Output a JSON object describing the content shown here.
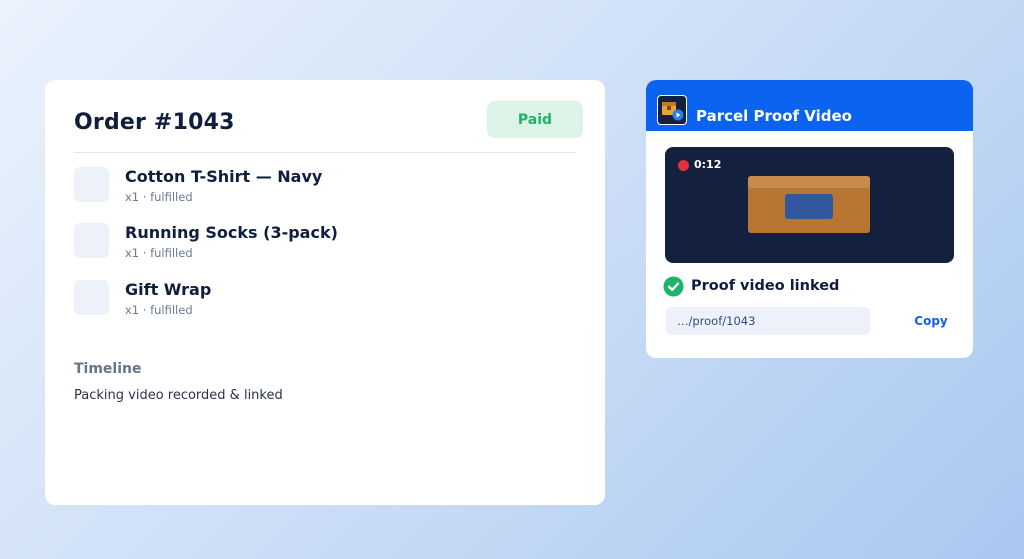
{
  "order": {
    "title": "Order #1043",
    "status_badge": "Paid",
    "items": [
      {
        "name": "Cotton T-Shirt — Navy",
        "meta": "x1 · fulfilled"
      },
      {
        "name": "Running Socks (3-pack)",
        "meta": "x1 · fulfilled"
      },
      {
        "name": "Gift Wrap",
        "meta": "x1 · fulfilled"
      }
    ],
    "timeline": {
      "heading": "Timeline",
      "entries": [
        "Packing video recorded & linked"
      ]
    }
  },
  "proof_panel": {
    "app_icon": "parcel-camera-icon",
    "title": "Parcel Proof Video",
    "video": {
      "recording_indicator": "red-dot",
      "timestamp": "0:12"
    },
    "status_icon": "check-circle-icon",
    "status_text": "Proof video linked",
    "link_value": "…/proof/1043",
    "copy_label": "Copy"
  },
  "colors": {
    "accent": "#0b63f0",
    "paid_badge_bg": "#dcf3e7",
    "paid_badge_text": "#22b36a",
    "success": "#1db36a",
    "recording": "#e0303b",
    "video_bg": "#13213f"
  }
}
